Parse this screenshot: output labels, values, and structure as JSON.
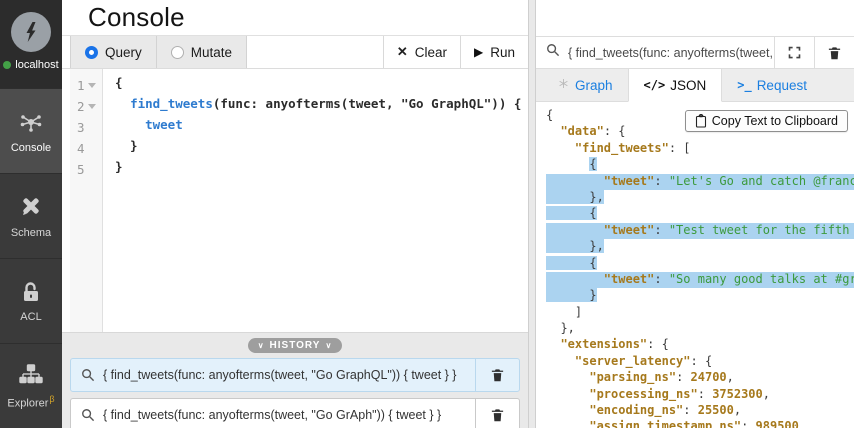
{
  "window": {
    "title": "Console"
  },
  "colors": {
    "accent_blue": "#1b7fe0",
    "selection_blue": "#abd3f0",
    "json_key_gold": "#a6791c",
    "json_string_green": "#3c9a3c",
    "code_blue": "#2e7bcf",
    "status_green": "#43a047",
    "sidebar_dark": "#3a3a3a"
  },
  "icons": {
    "run_glyph": "▶",
    "clear_glyph": "✕",
    "history_chevron": "∨",
    "json_tab_glyph": "</>",
    "request_tab_glyph": ">_"
  },
  "sidebar": {
    "brand": {
      "status": "localhost"
    },
    "items": [
      {
        "label": "Console",
        "icon": "graph-network-icon",
        "active": true
      },
      {
        "label": "Schema",
        "icon": "tools-icon",
        "active": false
      },
      {
        "label": "ACL",
        "icon": "lock-icon",
        "active": false
      },
      {
        "label": "Explorer",
        "icon": "sitemap-icon",
        "beta": "β",
        "active": false
      }
    ]
  },
  "toolbar": {
    "query_label": "Query",
    "mutate_label": "Mutate",
    "clear_label": "Clear",
    "run_label": "Run",
    "selected_mode": "Query"
  },
  "editor": {
    "lines": [
      {
        "no": "1",
        "fold": true,
        "segments": [
          {
            "t": "{",
            "c": "plain"
          }
        ]
      },
      {
        "no": "2",
        "fold": true,
        "segments": [
          {
            "t": "  ",
            "c": "plain"
          },
          {
            "t": "find_tweets",
            "c": "blue"
          },
          {
            "t": "(func: anyofterms(tweet, \"Go GraphQL\")) {",
            "c": "plain"
          }
        ]
      },
      {
        "no": "3",
        "fold": false,
        "segments": [
          {
            "t": "    ",
            "c": "plain"
          },
          {
            "t": "tweet",
            "c": "blue"
          }
        ]
      },
      {
        "no": "4",
        "fold": false,
        "segments": [
          {
            "t": "  }",
            "c": "plain"
          }
        ]
      },
      {
        "no": "5",
        "fold": false,
        "segments": [
          {
            "t": "}",
            "c": "plain"
          }
        ]
      }
    ]
  },
  "history": {
    "label": "HISTORY",
    "items": [
      {
        "query": "{ find_tweets(func: anyofterms(tweet, \"Go GraphQL\")) { tweet } }",
        "active": true
      },
      {
        "query": "{ find_tweets(func: anyofterms(tweet, \"Go GrAph\")) { tweet } }",
        "active": false
      }
    ]
  },
  "results": {
    "search_value": "{ find_tweets(func: anyofterms(tweet, \"Go ...",
    "tabs": [
      {
        "label": "Graph",
        "active": false
      },
      {
        "label": "JSON",
        "active": true
      },
      {
        "label": "Request",
        "active": false
      }
    ],
    "copy_button_label": "Copy Text to Clipboard",
    "json_lines": [
      {
        "segments": [
          {
            "t": "{",
            "c": "p"
          }
        ]
      },
      {
        "segments": [
          {
            "t": "  ",
            "c": "p"
          },
          {
            "t": "\"data\"",
            "c": "k"
          },
          {
            "t": ": {",
            "c": "p"
          }
        ]
      },
      {
        "segments": [
          {
            "t": "    ",
            "c": "p"
          },
          {
            "t": "\"find_tweets\"",
            "c": "k"
          },
          {
            "t": ": [",
            "c": "p"
          }
        ]
      },
      {
        "segments": [
          {
            "t": "      ",
            "c": "p"
          },
          {
            "t": "{",
            "c": "p",
            "hl": true
          }
        ]
      },
      {
        "full": true,
        "segments": [
          {
            "t": "        ",
            "c": "p"
          },
          {
            "t": "\"tweet\"",
            "c": "k"
          },
          {
            "t": ": ",
            "c": "p"
          },
          {
            "t": "\"Let's Go and catch @francesc",
            "c": "s"
          }
        ]
      },
      {
        "segments": [
          {
            "t": "      },",
            "c": "p",
            "hl": true
          }
        ]
      },
      {
        "segments": [
          {
            "t": "      {",
            "c": "p",
            "hl": true
          }
        ]
      },
      {
        "full": true,
        "segments": [
          {
            "t": "        ",
            "c": "p"
          },
          {
            "t": "\"tweet\"",
            "c": "k"
          },
          {
            "t": ": ",
            "c": "p"
          },
          {
            "t": "\"Test tweet for the fifth epis",
            "c": "s"
          }
        ]
      },
      {
        "segments": [
          {
            "t": "      },",
            "c": "p",
            "hl": true
          }
        ]
      },
      {
        "segments": [
          {
            "t": "      {",
            "c": "p",
            "hl": true
          }
        ]
      },
      {
        "full": true,
        "segments": [
          {
            "t": "        ",
            "c": "p"
          },
          {
            "t": "\"tweet\"",
            "c": "k"
          },
          {
            "t": ": ",
            "c": "p"
          },
          {
            "t": "\"So many good talks at #grapho",
            "c": "s"
          }
        ]
      },
      {
        "segments": [
          {
            "t": "      }",
            "c": "p",
            "hl": true
          }
        ]
      },
      {
        "segments": [
          {
            "t": "    ]",
            "c": "p"
          }
        ]
      },
      {
        "segments": [
          {
            "t": "  },",
            "c": "p"
          }
        ]
      },
      {
        "segments": [
          {
            "t": "  ",
            "c": "p"
          },
          {
            "t": "\"extensions\"",
            "c": "k"
          },
          {
            "t": ": {",
            "c": "p"
          }
        ]
      },
      {
        "segments": [
          {
            "t": "    ",
            "c": "p"
          },
          {
            "t": "\"server_latency\"",
            "c": "k"
          },
          {
            "t": ": {",
            "c": "p"
          }
        ]
      },
      {
        "segments": [
          {
            "t": "      ",
            "c": "p"
          },
          {
            "t": "\"parsing_ns\"",
            "c": "k"
          },
          {
            "t": ": ",
            "c": "p"
          },
          {
            "t": "24700",
            "c": "n"
          },
          {
            "t": ",",
            "c": "p"
          }
        ]
      },
      {
        "segments": [
          {
            "t": "      ",
            "c": "p"
          },
          {
            "t": "\"processing_ns\"",
            "c": "k"
          },
          {
            "t": ": ",
            "c": "p"
          },
          {
            "t": "3752300",
            "c": "n"
          },
          {
            "t": ",",
            "c": "p"
          }
        ]
      },
      {
        "segments": [
          {
            "t": "      ",
            "c": "p"
          },
          {
            "t": "\"encoding_ns\"",
            "c": "k"
          },
          {
            "t": ": ",
            "c": "p"
          },
          {
            "t": "25500",
            "c": "n"
          },
          {
            "t": ",",
            "c": "p"
          }
        ]
      },
      {
        "segments": [
          {
            "t": "      ",
            "c": "p"
          },
          {
            "t": "\"assign_timestamp_ns\"",
            "c": "k"
          },
          {
            "t": ": ",
            "c": "p"
          },
          {
            "t": "989500",
            "c": "n"
          }
        ]
      }
    ]
  }
}
